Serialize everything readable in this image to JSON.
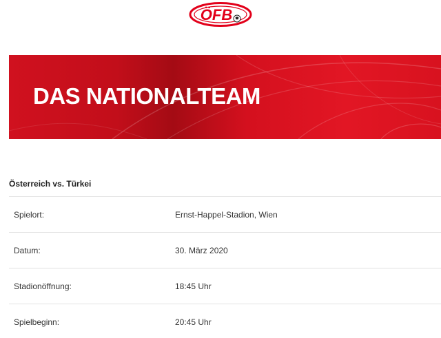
{
  "header": {
    "logo_text": "ÖFB",
    "logo_color": "#e2001a"
  },
  "banner": {
    "title": "DAS NATIONALTEAM",
    "color": "#d0111f"
  },
  "match": {
    "title": "Österreich vs. Türkei"
  },
  "details": [
    {
      "label": "Spielort:",
      "value": "Ernst-Happel-Stadion, Wien"
    },
    {
      "label": "Datum:",
      "value": "30. März 2020"
    },
    {
      "label": "Stadionöffnung:",
      "value": "18:45 Uhr"
    },
    {
      "label": "Spielbeginn:",
      "value": "20:45 Uhr"
    }
  ]
}
